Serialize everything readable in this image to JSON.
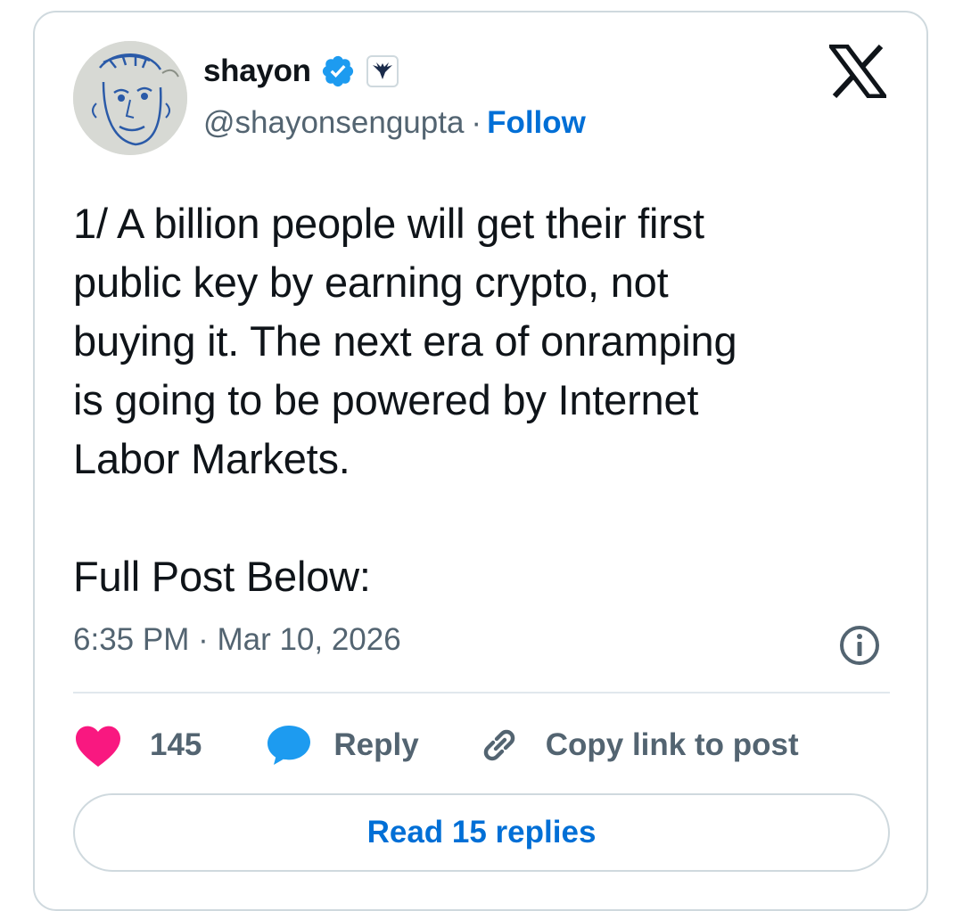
{
  "author": {
    "name": "shayon",
    "handle": "@shayonsengupta",
    "separator": "·",
    "follow_label": "Follow",
    "verified_icon": "verified-badge-icon",
    "affiliation_icon": "phoenix-affiliation-icon"
  },
  "brand": {
    "logo": "x-logo-icon"
  },
  "tweet": {
    "text": "1/ A billion people will get their first\npublic key by earning crypto, not\nbuying it. The next era of onramping\nis going to be powered by Internet\nLabor Markets.\n\nFull Post Below:",
    "timestamp": "6:35 PM · Mar 10, 2026"
  },
  "actions": {
    "like_count": "145",
    "reply_label": "Reply",
    "copy_label": "Copy link to post"
  },
  "footer": {
    "read_replies_label": "Read 15 replies"
  },
  "colors": {
    "accent": "#006fd6",
    "verified": "#1d9bf0",
    "like": "#f91880",
    "muted": "#536471",
    "border": "#cfd9de"
  }
}
